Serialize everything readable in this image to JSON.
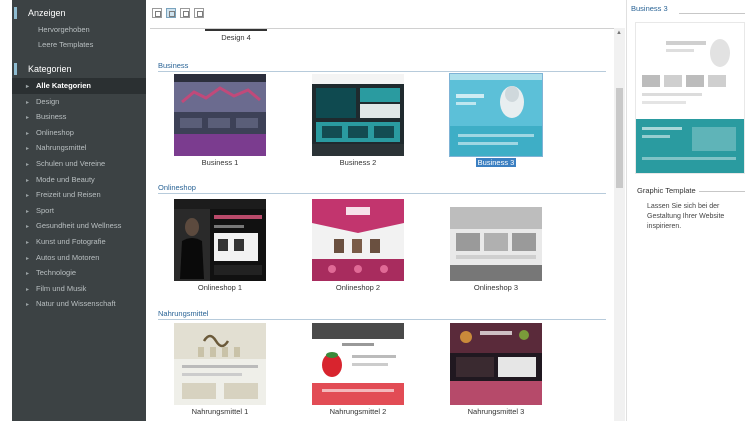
{
  "sidebar": {
    "show_header": "Anzeigen",
    "show_items": [
      "Hervorgehoben",
      "Leere Templates"
    ],
    "categories_header": "Kategorien",
    "categories": [
      {
        "label": "Alle Kategorien",
        "active": true
      },
      {
        "label": "Design"
      },
      {
        "label": "Business"
      },
      {
        "label": "Onlineshop"
      },
      {
        "label": "Nahrungsmittel"
      },
      {
        "label": "Schulen und Vereine"
      },
      {
        "label": "Mode und Beauty"
      },
      {
        "label": "Freizeit und Reisen"
      },
      {
        "label": "Sport"
      },
      {
        "label": "Gesundheit und Wellness"
      },
      {
        "label": "Kunst und Fotografie"
      },
      {
        "label": "Autos und Motoren"
      },
      {
        "label": "Technologie"
      },
      {
        "label": "Film und Musik"
      },
      {
        "label": "Natur und Wissenschaft"
      }
    ]
  },
  "toolbar": {
    "buttons": [
      "small-grid-view",
      "medium-grid-view",
      "large-grid-view",
      "list-view"
    ],
    "selected": "medium-grid-view"
  },
  "main": {
    "partial_caption": "Design 4",
    "sections": [
      {
        "title": "Business",
        "items": [
          "Business 1",
          "Business 2",
          "Business 3"
        ],
        "selected_index": 2
      },
      {
        "title": "Onlineshop",
        "items": [
          "Onlineshop 1",
          "Onlineshop 2",
          "Onlineshop 3"
        ]
      },
      {
        "title": "Nahrungsmittel",
        "items": [
          "Nahrungsmittel 1",
          "Nahrungsmittel 2",
          "Nahrungsmittel 3"
        ]
      }
    ]
  },
  "preview": {
    "title": "Business 3",
    "section_title": "Graphic Template",
    "description": "Lassen Sie sich bei der Gestaltung Ihrer Website inspirieren."
  },
  "colors": {
    "sidebar_bg": "#3c4244",
    "accent": "#3b7fc1",
    "link_blue": "#2a6496",
    "teal": "#2a9ba0"
  }
}
